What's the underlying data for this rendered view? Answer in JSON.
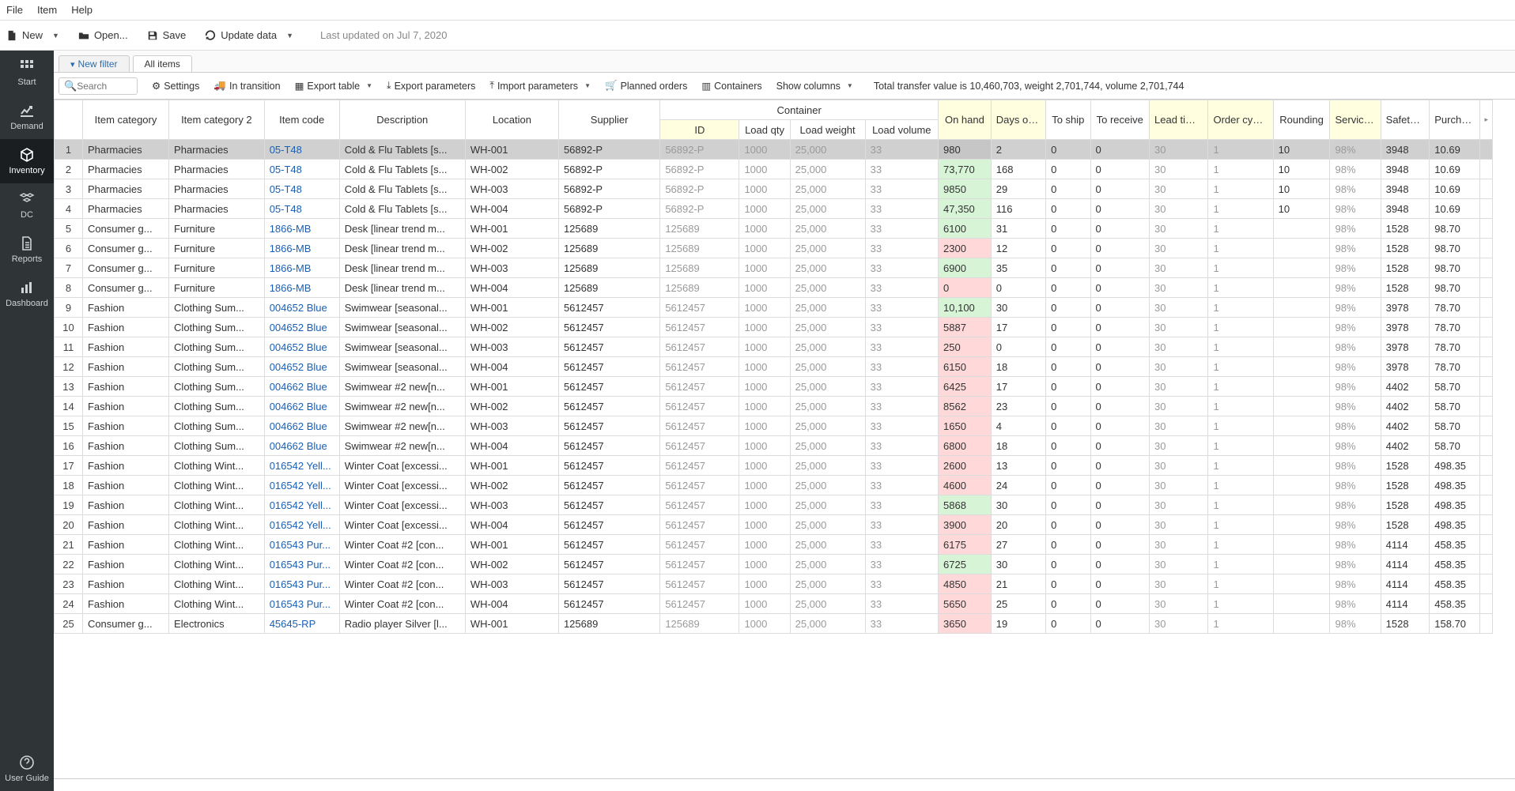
{
  "menu": {
    "file": "File",
    "item": "Item",
    "help": "Help"
  },
  "toolbar": {
    "new": "New",
    "open": "Open...",
    "save": "Save",
    "update": "Update data",
    "lastupd": "Last updated on Jul 7, 2020"
  },
  "sidebar": {
    "items": [
      {
        "label": "Start"
      },
      {
        "label": "Demand"
      },
      {
        "label": "Inventory"
      },
      {
        "label": "DC"
      },
      {
        "label": "Reports"
      },
      {
        "label": "Dashboard"
      }
    ],
    "userguide": "User Guide"
  },
  "tabs": {
    "newfilter": "New filter",
    "all": "All items"
  },
  "actions": {
    "search_ph": "Search",
    "settings": "Settings",
    "intransition": "In transition",
    "exporttable": "Export table",
    "exportparams": "Export parameters",
    "importparams": "Import parameters",
    "planned": "Planned orders",
    "containers": "Containers",
    "showcols": "Show columns",
    "total": "Total transfer value is 10,460,703, weight 2,701,744, volume 2,701,744"
  },
  "headers": {
    "cat": "Item category",
    "cat2": "Item category 2",
    "code": "Item code",
    "desc": "Description",
    "loc": "Location",
    "sup": "Supplier",
    "container": "Container",
    "cid": "ID",
    "cqty": "Load qty",
    "cwt": "Load weight",
    "cvol": "Load volume",
    "oh": "On hand",
    "dos": "Days of supply",
    "ship": "To ship",
    "recv": "To receive",
    "lead": "Lead time, days",
    "cyc": "Order cycle, months",
    "round": "Rounding",
    "svc": "Service level, %",
    "ss": "Safety stock",
    "pp": "Purchase price"
  },
  "rows": [
    {
      "n": 1,
      "cat": "Pharmacies",
      "cat2": "Pharmacies",
      "code": "05-T48",
      "desc": "Cold & Flu Tablets [s...",
      "loc": "WH-001",
      "sup": "56892-P",
      "cid": "56892-P",
      "cqty": "1000",
      "cwt": "25,000",
      "cvol": "33",
      "oh": "980",
      "oh_c": "red",
      "dos": "2",
      "ship": "0",
      "recv": "0",
      "lead": "30",
      "cyc": "1",
      "round": "10",
      "svc": "98%",
      "ss": "3948",
      "pp": "10.69",
      "sel": true
    },
    {
      "n": 2,
      "cat": "Pharmacies",
      "cat2": "Pharmacies",
      "code": "05-T48",
      "desc": "Cold & Flu Tablets [s...",
      "loc": "WH-002",
      "sup": "56892-P",
      "cid": "56892-P",
      "cqty": "1000",
      "cwt": "25,000",
      "cvol": "33",
      "oh": "73,770",
      "oh_c": "green",
      "dos": "168",
      "ship": "0",
      "recv": "0",
      "lead": "30",
      "cyc": "1",
      "round": "10",
      "svc": "98%",
      "ss": "3948",
      "pp": "10.69"
    },
    {
      "n": 3,
      "cat": "Pharmacies",
      "cat2": "Pharmacies",
      "code": "05-T48",
      "desc": "Cold & Flu Tablets [s...",
      "loc": "WH-003",
      "sup": "56892-P",
      "cid": "56892-P",
      "cqty": "1000",
      "cwt": "25,000",
      "cvol": "33",
      "oh": "9850",
      "oh_c": "green",
      "dos": "29",
      "ship": "0",
      "recv": "0",
      "lead": "30",
      "cyc": "1",
      "round": "10",
      "svc": "98%",
      "ss": "3948",
      "pp": "10.69"
    },
    {
      "n": 4,
      "cat": "Pharmacies",
      "cat2": "Pharmacies",
      "code": "05-T48",
      "desc": "Cold & Flu Tablets [s...",
      "loc": "WH-004",
      "sup": "56892-P",
      "cid": "56892-P",
      "cqty": "1000",
      "cwt": "25,000",
      "cvol": "33",
      "oh": "47,350",
      "oh_c": "green",
      "dos": "116",
      "ship": "0",
      "recv": "0",
      "lead": "30",
      "cyc": "1",
      "round": "10",
      "svc": "98%",
      "ss": "3948",
      "pp": "10.69"
    },
    {
      "n": 5,
      "cat": "Consumer g...",
      "cat2": "Furniture",
      "code": "1866-MB",
      "desc": "Desk [linear trend m...",
      "loc": "WH-001",
      "sup": "125689",
      "cid": "125689",
      "cqty": "1000",
      "cwt": "25,000",
      "cvol": "33",
      "oh": "6100",
      "oh_c": "green",
      "dos": "31",
      "ship": "0",
      "recv": "0",
      "lead": "30",
      "cyc": "1",
      "round": "",
      "svc": "98%",
      "ss": "1528",
      "pp": "98.70"
    },
    {
      "n": 6,
      "cat": "Consumer g...",
      "cat2": "Furniture",
      "code": "1866-MB",
      "desc": "Desk [linear trend m...",
      "loc": "WH-002",
      "sup": "125689",
      "cid": "125689",
      "cqty": "1000",
      "cwt": "25,000",
      "cvol": "33",
      "oh": "2300",
      "oh_c": "red",
      "dos": "12",
      "ship": "0",
      "recv": "0",
      "lead": "30",
      "cyc": "1",
      "round": "",
      "svc": "98%",
      "ss": "1528",
      "pp": "98.70"
    },
    {
      "n": 7,
      "cat": "Consumer g...",
      "cat2": "Furniture",
      "code": "1866-MB",
      "desc": "Desk [linear trend m...",
      "loc": "WH-003",
      "sup": "125689",
      "cid": "125689",
      "cqty": "1000",
      "cwt": "25,000",
      "cvol": "33",
      "oh": "6900",
      "oh_c": "green",
      "dos": "35",
      "ship": "0",
      "recv": "0",
      "lead": "30",
      "cyc": "1",
      "round": "",
      "svc": "98%",
      "ss": "1528",
      "pp": "98.70"
    },
    {
      "n": 8,
      "cat": "Consumer g...",
      "cat2": "Furniture",
      "code": "1866-MB",
      "desc": "Desk [linear trend m...",
      "loc": "WH-004",
      "sup": "125689",
      "cid": "125689",
      "cqty": "1000",
      "cwt": "25,000",
      "cvol": "33",
      "oh": "0",
      "oh_c": "red",
      "dos": "0",
      "ship": "0",
      "recv": "0",
      "lead": "30",
      "cyc": "1",
      "round": "",
      "svc": "98%",
      "ss": "1528",
      "pp": "98.70"
    },
    {
      "n": 9,
      "cat": "Fashion",
      "cat2": "Clothing Sum...",
      "code": "004652 Blue",
      "desc": "Swimwear [seasonal...",
      "loc": "WH-001",
      "sup": "5612457",
      "cid": "5612457",
      "cqty": "1000",
      "cwt": "25,000",
      "cvol": "33",
      "oh": "10,100",
      "oh_c": "green",
      "dos": "30",
      "ship": "0",
      "recv": "0",
      "lead": "30",
      "cyc": "1",
      "round": "",
      "svc": "98%",
      "ss": "3978",
      "pp": "78.70"
    },
    {
      "n": 10,
      "cat": "Fashion",
      "cat2": "Clothing Sum...",
      "code": "004652 Blue",
      "desc": "Swimwear [seasonal...",
      "loc": "WH-002",
      "sup": "5612457",
      "cid": "5612457",
      "cqty": "1000",
      "cwt": "25,000",
      "cvol": "33",
      "oh": "5887",
      "oh_c": "red",
      "dos": "17",
      "ship": "0",
      "recv": "0",
      "lead": "30",
      "cyc": "1",
      "round": "",
      "svc": "98%",
      "ss": "3978",
      "pp": "78.70"
    },
    {
      "n": 11,
      "cat": "Fashion",
      "cat2": "Clothing Sum...",
      "code": "004652 Blue",
      "desc": "Swimwear [seasonal...",
      "loc": "WH-003",
      "sup": "5612457",
      "cid": "5612457",
      "cqty": "1000",
      "cwt": "25,000",
      "cvol": "33",
      "oh": "250",
      "oh_c": "red",
      "dos": "0",
      "ship": "0",
      "recv": "0",
      "lead": "30",
      "cyc": "1",
      "round": "",
      "svc": "98%",
      "ss": "3978",
      "pp": "78.70"
    },
    {
      "n": 12,
      "cat": "Fashion",
      "cat2": "Clothing Sum...",
      "code": "004652 Blue",
      "desc": "Swimwear [seasonal...",
      "loc": "WH-004",
      "sup": "5612457",
      "cid": "5612457",
      "cqty": "1000",
      "cwt": "25,000",
      "cvol": "33",
      "oh": "6150",
      "oh_c": "red",
      "dos": "18",
      "ship": "0",
      "recv": "0",
      "lead": "30",
      "cyc": "1",
      "round": "",
      "svc": "98%",
      "ss": "3978",
      "pp": "78.70"
    },
    {
      "n": 13,
      "cat": "Fashion",
      "cat2": "Clothing Sum...",
      "code": "004662 Blue",
      "desc": "Swimwear #2 new[n...",
      "loc": "WH-001",
      "sup": "5612457",
      "cid": "5612457",
      "cqty": "1000",
      "cwt": "25,000",
      "cvol": "33",
      "oh": "6425",
      "oh_c": "red",
      "dos": "17",
      "ship": "0",
      "recv": "0",
      "lead": "30",
      "cyc": "1",
      "round": "",
      "svc": "98%",
      "ss": "4402",
      "pp": "58.70"
    },
    {
      "n": 14,
      "cat": "Fashion",
      "cat2": "Clothing Sum...",
      "code": "004662 Blue",
      "desc": "Swimwear #2 new[n...",
      "loc": "WH-002",
      "sup": "5612457",
      "cid": "5612457",
      "cqty": "1000",
      "cwt": "25,000",
      "cvol": "33",
      "oh": "8562",
      "oh_c": "red",
      "dos": "23",
      "ship": "0",
      "recv": "0",
      "lead": "30",
      "cyc": "1",
      "round": "",
      "svc": "98%",
      "ss": "4402",
      "pp": "58.70"
    },
    {
      "n": 15,
      "cat": "Fashion",
      "cat2": "Clothing Sum...",
      "code": "004662 Blue",
      "desc": "Swimwear #2 new[n...",
      "loc": "WH-003",
      "sup": "5612457",
      "cid": "5612457",
      "cqty": "1000",
      "cwt": "25,000",
      "cvol": "33",
      "oh": "1650",
      "oh_c": "red",
      "dos": "4",
      "ship": "0",
      "recv": "0",
      "lead": "30",
      "cyc": "1",
      "round": "",
      "svc": "98%",
      "ss": "4402",
      "pp": "58.70"
    },
    {
      "n": 16,
      "cat": "Fashion",
      "cat2": "Clothing Sum...",
      "code": "004662 Blue",
      "desc": "Swimwear #2 new[n...",
      "loc": "WH-004",
      "sup": "5612457",
      "cid": "5612457",
      "cqty": "1000",
      "cwt": "25,000",
      "cvol": "33",
      "oh": "6800",
      "oh_c": "red",
      "dos": "18",
      "ship": "0",
      "recv": "0",
      "lead": "30",
      "cyc": "1",
      "round": "",
      "svc": "98%",
      "ss": "4402",
      "pp": "58.70"
    },
    {
      "n": 17,
      "cat": "Fashion",
      "cat2": "Clothing Wint...",
      "code": "016542 Yell...",
      "desc": "Winter Coat [excessi...",
      "loc": "WH-001",
      "sup": "5612457",
      "cid": "5612457",
      "cqty": "1000",
      "cwt": "25,000",
      "cvol": "33",
      "oh": "2600",
      "oh_c": "red",
      "dos": "13",
      "ship": "0",
      "recv": "0",
      "lead": "30",
      "cyc": "1",
      "round": "",
      "svc": "98%",
      "ss": "1528",
      "pp": "498.35"
    },
    {
      "n": 18,
      "cat": "Fashion",
      "cat2": "Clothing Wint...",
      "code": "016542 Yell...",
      "desc": "Winter Coat [excessi...",
      "loc": "WH-002",
      "sup": "5612457",
      "cid": "5612457",
      "cqty": "1000",
      "cwt": "25,000",
      "cvol": "33",
      "oh": "4600",
      "oh_c": "red",
      "dos": "24",
      "ship": "0",
      "recv": "0",
      "lead": "30",
      "cyc": "1",
      "round": "",
      "svc": "98%",
      "ss": "1528",
      "pp": "498.35"
    },
    {
      "n": 19,
      "cat": "Fashion",
      "cat2": "Clothing Wint...",
      "code": "016542 Yell...",
      "desc": "Winter Coat [excessi...",
      "loc": "WH-003",
      "sup": "5612457",
      "cid": "5612457",
      "cqty": "1000",
      "cwt": "25,000",
      "cvol": "33",
      "oh": "5868",
      "oh_c": "green",
      "dos": "30",
      "ship": "0",
      "recv": "0",
      "lead": "30",
      "cyc": "1",
      "round": "",
      "svc": "98%",
      "ss": "1528",
      "pp": "498.35"
    },
    {
      "n": 20,
      "cat": "Fashion",
      "cat2": "Clothing Wint...",
      "code": "016542 Yell...",
      "desc": "Winter Coat [excessi...",
      "loc": "WH-004",
      "sup": "5612457",
      "cid": "5612457",
      "cqty": "1000",
      "cwt": "25,000",
      "cvol": "33",
      "oh": "3900",
      "oh_c": "red",
      "dos": "20",
      "ship": "0",
      "recv": "0",
      "lead": "30",
      "cyc": "1",
      "round": "",
      "svc": "98%",
      "ss": "1528",
      "pp": "498.35"
    },
    {
      "n": 21,
      "cat": "Fashion",
      "cat2": "Clothing Wint...",
      "code": "016543 Pur...",
      "desc": "Winter Coat #2 [con...",
      "loc": "WH-001",
      "sup": "5612457",
      "cid": "5612457",
      "cqty": "1000",
      "cwt": "25,000",
      "cvol": "33",
      "oh": "6175",
      "oh_c": "red",
      "dos": "27",
      "ship": "0",
      "recv": "0",
      "lead": "30",
      "cyc": "1",
      "round": "",
      "svc": "98%",
      "ss": "4114",
      "pp": "458.35"
    },
    {
      "n": 22,
      "cat": "Fashion",
      "cat2": "Clothing Wint...",
      "code": "016543 Pur...",
      "desc": "Winter Coat #2 [con...",
      "loc": "WH-002",
      "sup": "5612457",
      "cid": "5612457",
      "cqty": "1000",
      "cwt": "25,000",
      "cvol": "33",
      "oh": "6725",
      "oh_c": "green",
      "dos": "30",
      "ship": "0",
      "recv": "0",
      "lead": "30",
      "cyc": "1",
      "round": "",
      "svc": "98%",
      "ss": "4114",
      "pp": "458.35"
    },
    {
      "n": 23,
      "cat": "Fashion",
      "cat2": "Clothing Wint...",
      "code": "016543 Pur...",
      "desc": "Winter Coat #2 [con...",
      "loc": "WH-003",
      "sup": "5612457",
      "cid": "5612457",
      "cqty": "1000",
      "cwt": "25,000",
      "cvol": "33",
      "oh": "4850",
      "oh_c": "red",
      "dos": "21",
      "ship": "0",
      "recv": "0",
      "lead": "30",
      "cyc": "1",
      "round": "",
      "svc": "98%",
      "ss": "4114",
      "pp": "458.35"
    },
    {
      "n": 24,
      "cat": "Fashion",
      "cat2": "Clothing Wint...",
      "code": "016543 Pur...",
      "desc": "Winter Coat #2 [con...",
      "loc": "WH-004",
      "sup": "5612457",
      "cid": "5612457",
      "cqty": "1000",
      "cwt": "25,000",
      "cvol": "33",
      "oh": "5650",
      "oh_c": "red",
      "dos": "25",
      "ship": "0",
      "recv": "0",
      "lead": "30",
      "cyc": "1",
      "round": "",
      "svc": "98%",
      "ss": "4114",
      "pp": "458.35"
    },
    {
      "n": 25,
      "cat": "Consumer g...",
      "cat2": "Electronics",
      "code": "45645-RP",
      "desc": "Radio player Silver [l...",
      "loc": "WH-001",
      "sup": "125689",
      "cid": "125689",
      "cqty": "1000",
      "cwt": "25,000",
      "cvol": "33",
      "oh": "3650",
      "oh_c": "red",
      "dos": "19",
      "ship": "0",
      "recv": "0",
      "lead": "30",
      "cyc": "1",
      "round": "",
      "svc": "98%",
      "ss": "1528",
      "pp": "158.70"
    }
  ]
}
